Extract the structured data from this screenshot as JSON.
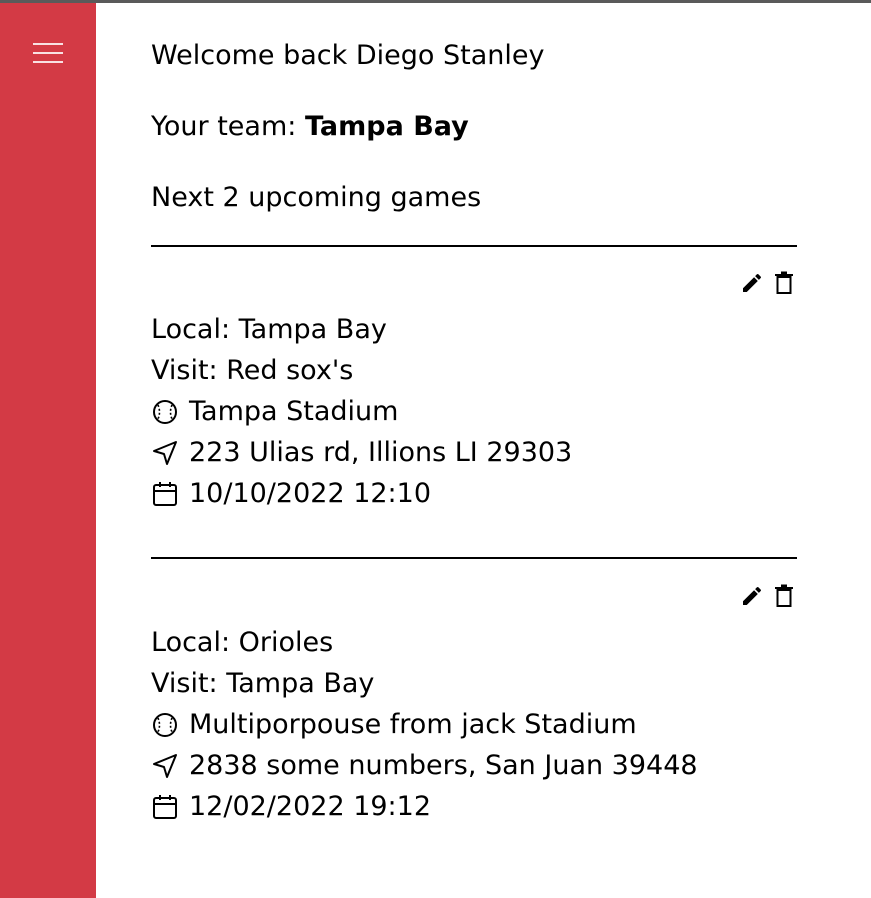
{
  "sidebar": {
    "menu_icon": "hamburger-menu-icon",
    "color": "#d33a45"
  },
  "main": {
    "welcome": "Welcome back Diego Stanley",
    "team_label": "Your team: ",
    "team_name": "Tampa Bay",
    "upcoming": "Next 2 upcoming games"
  },
  "games": [
    {
      "local": "Local: Tampa Bay",
      "visit": "Visit: Red sox's",
      "stadium": "Tampa Stadium",
      "address": "223 Ulias rd, Illions LI 29303",
      "datetime": "10/10/2022 12:10"
    },
    {
      "local": "Local: Orioles",
      "visit": "Visit: Tampa Bay",
      "stadium": "Multiporpouse from jack Stadium",
      "address": "2838 some numbers, San Juan 39448",
      "datetime": "12/02/2022 19:12"
    }
  ],
  "icons": {
    "edit": "pencil-icon",
    "delete": "trash-icon",
    "stadium": "baseball-icon",
    "address": "navigation-arrow-icon",
    "date": "calendar-icon"
  }
}
